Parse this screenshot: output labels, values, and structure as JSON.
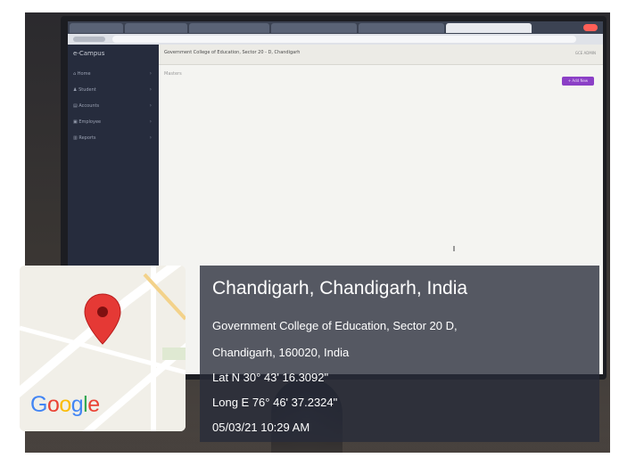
{
  "browser": {
    "tab_count": 6,
    "active_tab_index": 5
  },
  "app": {
    "brand": "e-Campus",
    "header_title": "Government College of Education, Sector 20 - D, Chandigarh",
    "header_user": "GCE ADMIN",
    "breadcrumb": "Masters",
    "add_button": "+ Add New"
  },
  "sidebar": {
    "items": [
      {
        "label": "Home",
        "icon": "home-icon"
      },
      {
        "label": "Student",
        "icon": "user-icon"
      },
      {
        "label": "Accounts",
        "icon": "wallet-icon"
      },
      {
        "label": "Employee",
        "icon": "briefcase-icon"
      },
      {
        "label": "Reports",
        "icon": "chart-icon"
      }
    ]
  },
  "geotag": {
    "city": "Chandigarh, Chandigarh, India",
    "address_line1": "Government College of Education, Sector 20 D,",
    "address_line2": "Chandigarh, 160020, India",
    "lat": "Lat N 30° 43' 16.3092\"",
    "long": "Long E 76° 46' 37.2324\"",
    "datetime": "05/03/21 10:29 AM"
  },
  "map": {
    "logo_letters": [
      "G",
      "o",
      "o",
      "g",
      "l",
      "e"
    ],
    "logo_colors": [
      "#4285F4",
      "#EA4335",
      "#FBBC05",
      "#4285F4",
      "#34A853",
      "#EA4335"
    ],
    "pin_color": "#E53935",
    "pin_icon": "map-pin-icon"
  }
}
